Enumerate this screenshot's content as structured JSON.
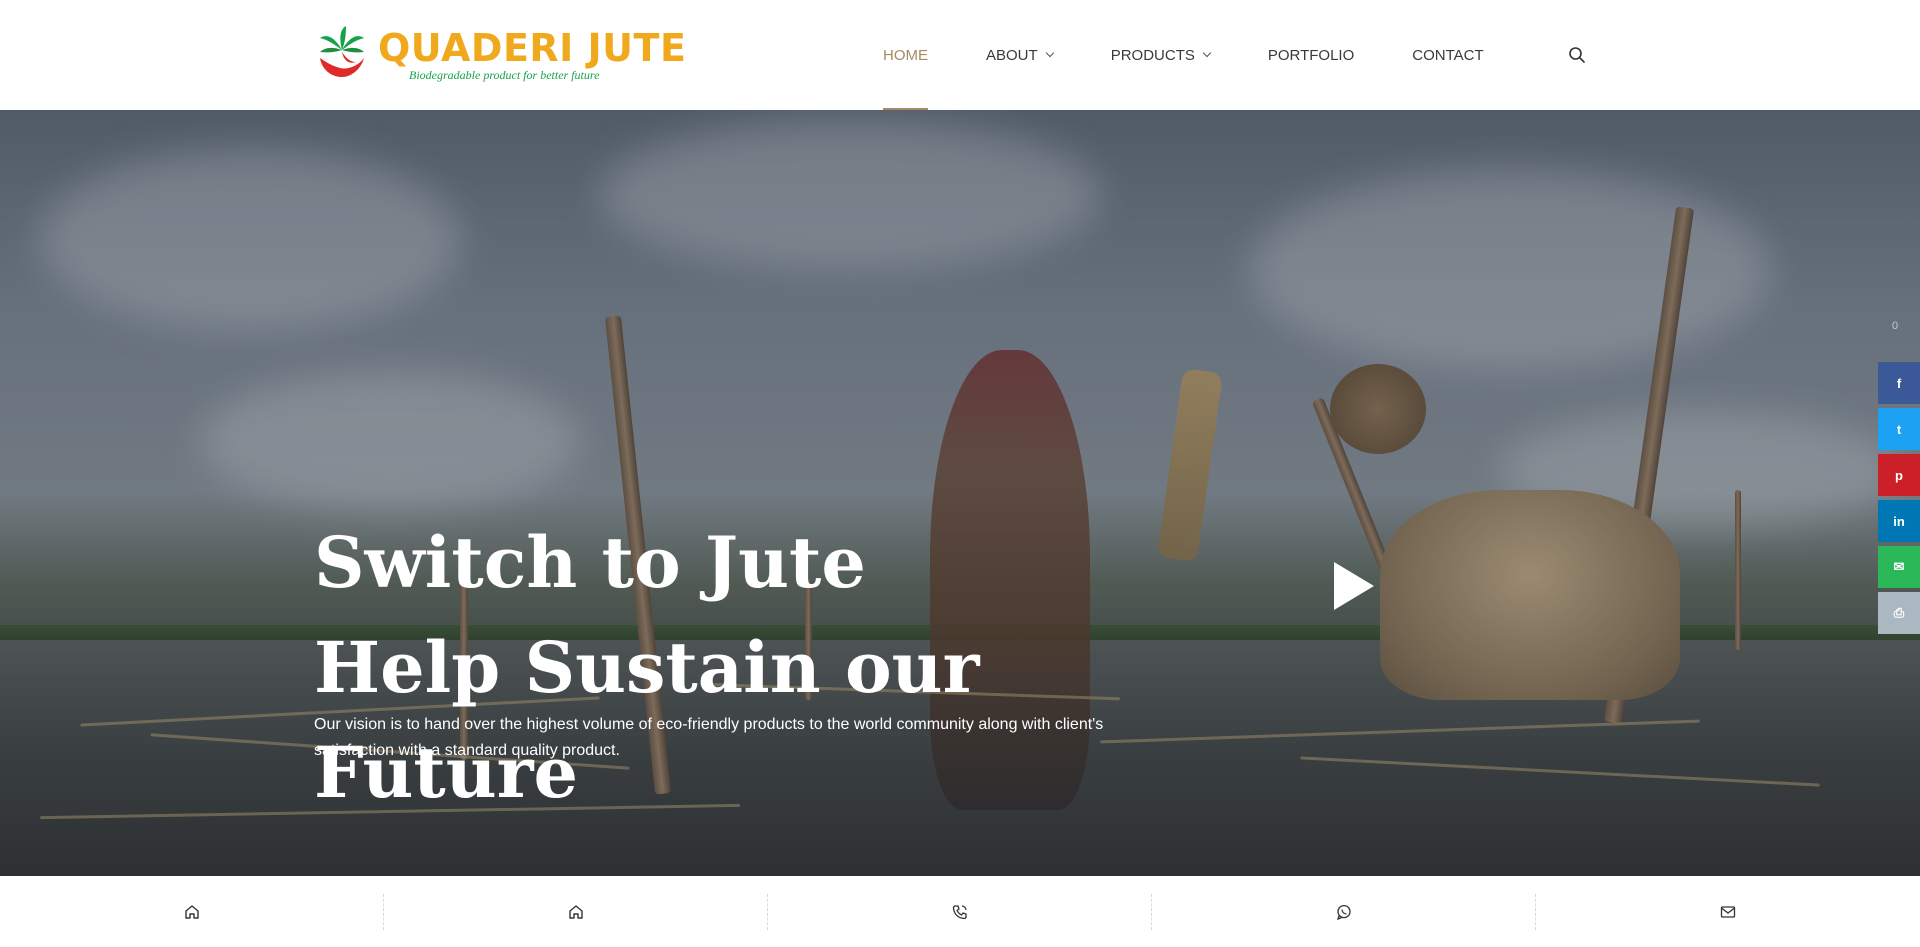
{
  "brand": {
    "name": "QUADERI JUTE",
    "tagline": "Biodegradable product for better future",
    "title_color": "#f0a81c",
    "tagline_color": "#17a24a"
  },
  "nav": {
    "items": [
      {
        "label": "HOME",
        "active": true
      },
      {
        "label": "ABOUT",
        "dropdown": true
      },
      {
        "label": "PRODUCTS",
        "dropdown": true
      },
      {
        "label": "PORTFOLIO"
      },
      {
        "label": "CONTACT"
      }
    ],
    "active_color": "#a68a64",
    "search_icon": "search-icon"
  },
  "hero": {
    "headline": [
      "Switch to Jute",
      "Help Sustain our",
      "Future"
    ],
    "description": "Our vision is to hand over the highest volume of eco-friendly products to the world community along with client's satisfaction with a standard quality product.",
    "play_icon": "play-icon"
  },
  "social": {
    "share_count": "0",
    "buttons": [
      {
        "icon": "facebook-icon",
        "glyph": "f",
        "color": "#3b5998"
      },
      {
        "icon": "twitter-icon",
        "glyph": "t",
        "color": "#1da1f2"
      },
      {
        "icon": "pinterest-icon",
        "glyph": "p",
        "color": "#cb2027"
      },
      {
        "icon": "linkedin-icon",
        "glyph": "in",
        "color": "#0077b5"
      },
      {
        "icon": "email-icon",
        "glyph": "✉",
        "color": "#2ab859"
      },
      {
        "icon": "print-icon",
        "glyph": "⎙",
        "color": "#aab8c2"
      }
    ]
  },
  "bottom_bar": {
    "items": [
      "home-icon",
      "home-icon",
      "phone-icon",
      "whatsapp-icon",
      "mail-icon"
    ]
  }
}
